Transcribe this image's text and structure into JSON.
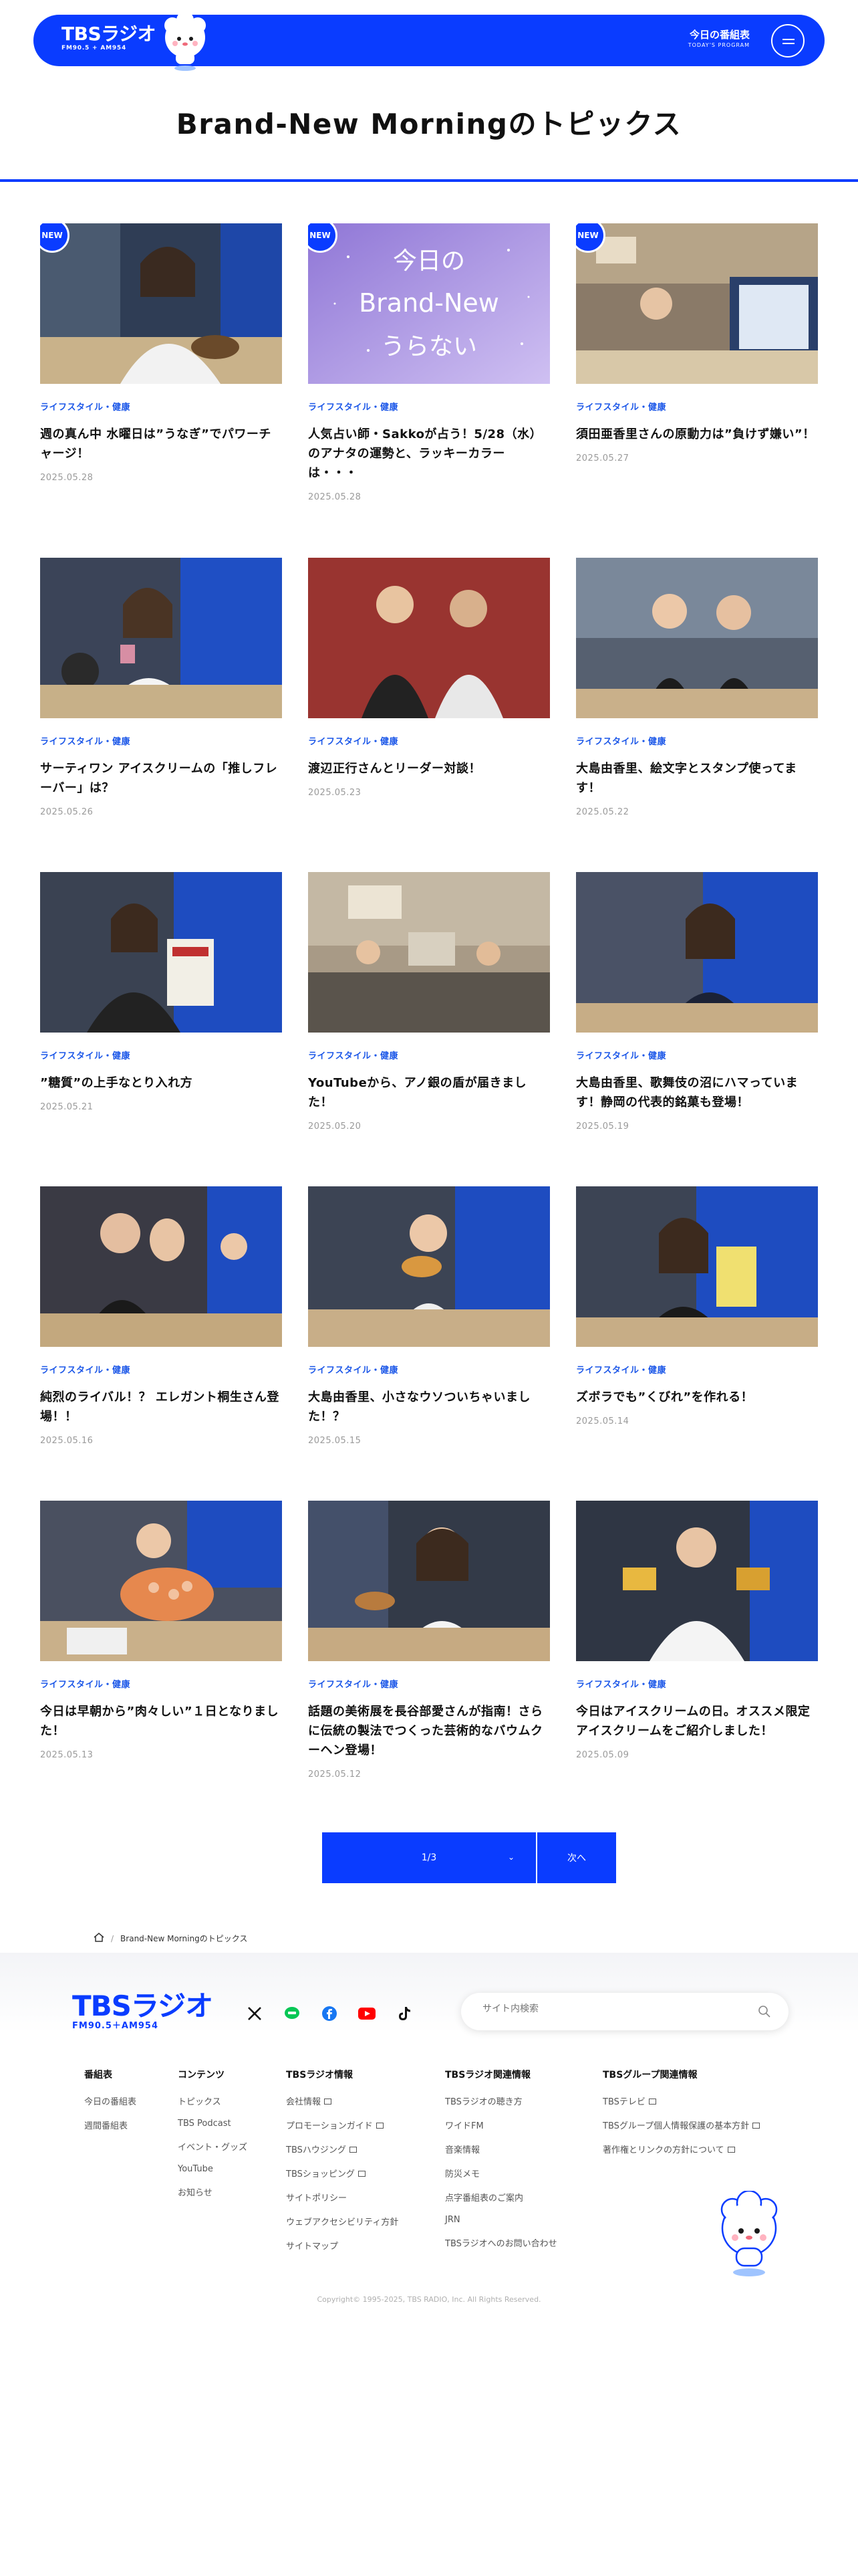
{
  "header": {
    "logo": "TBSラジオ",
    "logo_sub": "FM90.5 + AM954",
    "today_program": "今日の番組表",
    "today_program_en": "TODAY'S PROGRAM",
    "brand_color": "#0a3cff"
  },
  "page_title": "Brand-New Morningのトピックス",
  "new_label": "NEW",
  "articles": [
    {
      "category": "ライフスタイル・健康",
      "title": "週の真ん中 水曜日は”うなぎ”でパワーチャージ！",
      "date": "2025.05.28",
      "is_new": true
    },
    {
      "category": "ライフスタイル・健康",
      "title": "人気占い師・Sakkoが占う！5/28（水）のアナタの運勢と、ラッキーカラーは・・・",
      "date": "2025.05.28",
      "is_new": true,
      "image_text": [
        "今日の",
        "Brand-New",
        "うらない"
      ]
    },
    {
      "category": "ライフスタイル・健康",
      "title": "須田亜香里さんの原動力は”負けず嫌い”！",
      "date": "2025.05.27",
      "is_new": true
    },
    {
      "category": "ライフスタイル・健康",
      "title": "サーティワン アイスクリームの「推しフレーバー」は？",
      "date": "2025.05.26",
      "is_new": false
    },
    {
      "category": "ライフスタイル・健康",
      "title": "渡辺正行さんとリーダー対談！",
      "date": "2025.05.23",
      "is_new": false
    },
    {
      "category": "ライフスタイル・健康",
      "title": "大島由香里、絵文字とスタンプ使ってます！",
      "date": "2025.05.22",
      "is_new": false
    },
    {
      "category": "ライフスタイル・健康",
      "title": "”糖質”の上手なとり入れ方",
      "date": "2025.05.21",
      "is_new": false
    },
    {
      "category": "ライフスタイル・健康",
      "title": "YouTubeから、アノ銀の盾が届きました！",
      "date": "2025.05.20",
      "is_new": false
    },
    {
      "category": "ライフスタイル・健康",
      "title": "大島由香里、歌舞伎の沼にハマっています！静岡の代表的銘菓も登場！",
      "date": "2025.05.19",
      "is_new": false
    },
    {
      "category": "ライフスタイル・健康",
      "title": "純烈のライバル！？ エレガント桐生さん登場！！",
      "date": "2025.05.16",
      "is_new": false
    },
    {
      "category": "ライフスタイル・健康",
      "title": "大島由香里、小さなウソついちゃいました！？",
      "date": "2025.05.15",
      "is_new": false
    },
    {
      "category": "ライフスタイル・健康",
      "title": "ズボラでも”くびれ”を作れる！",
      "date": "2025.05.14",
      "is_new": false
    },
    {
      "category": "ライフスタイル・健康",
      "title": "今日は早朝から”肉々しい”１日となりました！",
      "date": "2025.05.13",
      "is_new": false
    },
    {
      "category": "ライフスタイル・健康",
      "title": "話題の美術展を長谷部愛さんが指南！さらに伝統の製法でつくった芸術的なバウムクーヘン登場！",
      "date": "2025.05.12",
      "is_new": false
    },
    {
      "category": "ライフスタイル・健康",
      "title": "今日はアイスクリームの日。オススメ限定アイスクリームをご紹介しました！",
      "date": "2025.05.09",
      "is_new": false
    }
  ],
  "pagination": {
    "current": "1/3",
    "next": "次へ"
  },
  "breadcrumb": {
    "current": "Brand-New Morningのトピックス"
  },
  "footer": {
    "logo": "TBSラジオ",
    "logo_sub": "FM90.5＋AM954",
    "search_placeholder": "サイト内検索",
    "columns": [
      {
        "heading": "番組表",
        "links": [
          {
            "label": "今日の番組表"
          },
          {
            "label": "週間番組表"
          }
        ]
      },
      {
        "heading": "コンテンツ",
        "links": [
          {
            "label": "トピックス"
          },
          {
            "label": "TBS Podcast"
          },
          {
            "label": "イベント・グッズ"
          },
          {
            "label": "YouTube"
          },
          {
            "label": "お知らせ"
          }
        ]
      },
      {
        "heading": "TBSラジオ情報",
        "links": [
          {
            "label": "会社情報",
            "ext": true
          },
          {
            "label": "プロモーションガイド",
            "ext": true
          },
          {
            "label": "TBSハウジング",
            "ext": true
          },
          {
            "label": "TBSショッピング",
            "ext": true
          },
          {
            "label": "サイトポリシー"
          },
          {
            "label": "ウェブアクセシビリティ方針"
          },
          {
            "label": "サイトマップ"
          }
        ]
      },
      {
        "heading": "TBSラジオ関連情報",
        "links": [
          {
            "label": "TBSラジオの聴き方"
          },
          {
            "label": "ワイドFM"
          },
          {
            "label": "音楽情報"
          },
          {
            "label": "防災メモ"
          },
          {
            "label": "点字番組表のご案内"
          },
          {
            "label": "JRN"
          },
          {
            "label": "TBSラジオへのお問い合わせ"
          }
        ]
      },
      {
        "heading": "TBSグループ関連情報",
        "links": [
          {
            "label": "TBSテレビ",
            "ext": true
          },
          {
            "label": "TBSグループ個人情報保護の基本方針",
            "ext": true
          },
          {
            "label": "著作権とリンクの方針について",
            "ext": true
          }
        ]
      }
    ],
    "copyright": "Copyright© 1995-2025, TBS RADIO, Inc. All Rights Reserved."
  }
}
